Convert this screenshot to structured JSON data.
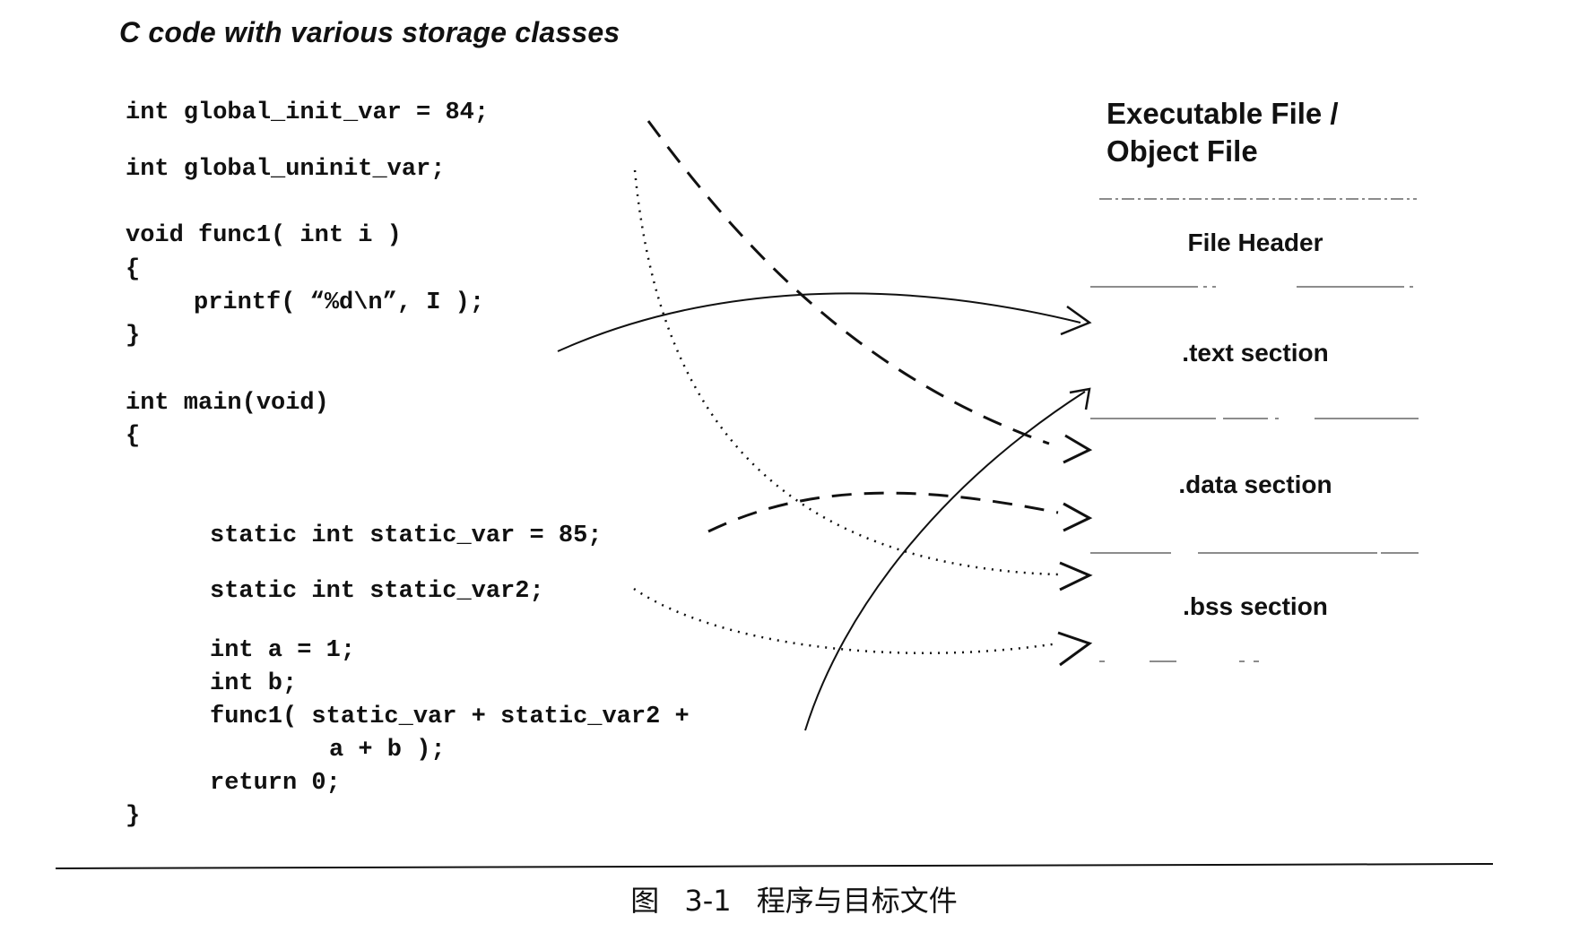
{
  "title": "C code with various storage classes",
  "code": {
    "line1": "int global_init_var = 84;",
    "line2": "int global_uninit_var;",
    "line3": "void func1( int i )",
    "line4": "{",
    "line5": "printf( “%d\\n”, I );",
    "line6": "}",
    "line7": "int main(void)",
    "line8": "{",
    "line9": "static int static_var = 85;",
    "line10": "static int static_var2;",
    "line11": "int a = 1;",
    "line12": "int b;",
    "line13": "func1( static_var + static_var2 +",
    "line14": "a + b );",
    "line15": "return 0;",
    "line16": "}"
  },
  "object_file": {
    "title": "Executable File /\nObject File",
    "sections": [
      {
        "label": "File Header"
      },
      {
        "label": ".text section"
      },
      {
        "label": ".data section"
      },
      {
        "label": ".bss section"
      }
    ]
  },
  "caption": "图 3-1 程序与目标文件"
}
